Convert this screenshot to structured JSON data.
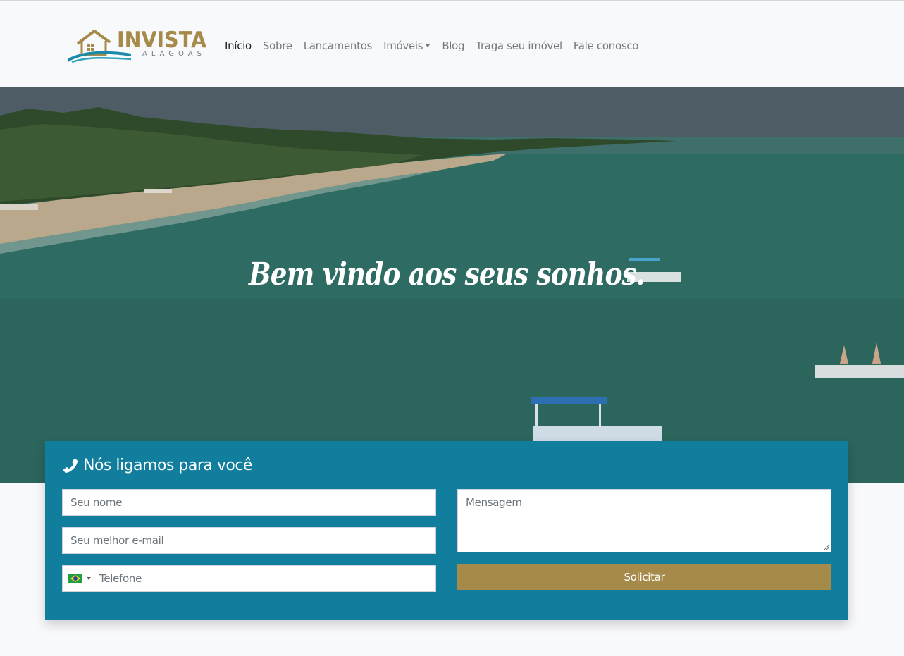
{
  "brand": {
    "name": "INVISTA",
    "subtitle": "ALAGOAS"
  },
  "nav": {
    "items": [
      {
        "label": "Início",
        "active": true
      },
      {
        "label": "Sobre"
      },
      {
        "label": "Lançamentos"
      },
      {
        "label": "Imóveis",
        "dropdown": true
      },
      {
        "label": "Blog"
      },
      {
        "label": "Traga seu imóvel"
      },
      {
        "label": "Fale conosco"
      }
    ]
  },
  "hero": {
    "title": "Bem vindo aos seus sonhos."
  },
  "callback": {
    "title": "Nós ligamos para você",
    "icon": "phone-icon",
    "name_placeholder": "Seu nome",
    "email_placeholder": "Seu melhor e-mail",
    "phone_placeholder": "Telefone",
    "message_placeholder": "Mensagem",
    "submit_label": "Solicitar",
    "country_flag": "brazil-flag-icon"
  },
  "colors": {
    "brand_gold": "#a68a4a",
    "card_blue": "#127e9e"
  }
}
